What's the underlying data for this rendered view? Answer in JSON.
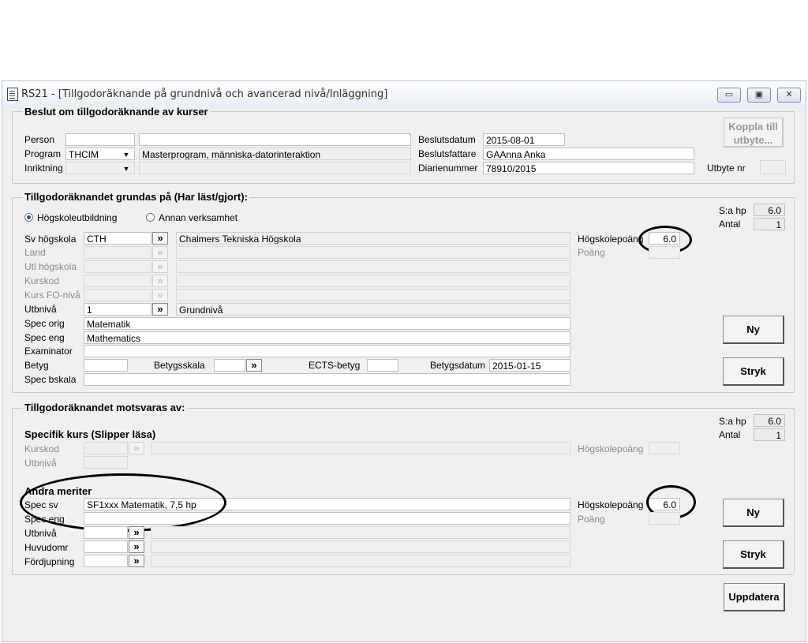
{
  "window": {
    "title": "RS21 - [Tillgodoräknande på grundnivå och avancerad nivå/Inläggning]",
    "minimize": "▭",
    "restore": "▣",
    "close": "✕"
  },
  "beslut": {
    "title": "Beslut om tillgodoräknande av kurser",
    "person_label": "Person",
    "person_id": "",
    "person_name": "",
    "program_label": "Program",
    "program_code": "THCIM",
    "program_name": "Masterprogram, människa-datorinteraktion",
    "inriktning_label": "Inriktning",
    "beslutsdatum_label": "Beslutsdatum",
    "beslutsdatum": "2015-08-01",
    "beslutsfattare_label": "Beslutsfattare",
    "beslutsfattare": "GAAnna Anka",
    "diarienummer_label": "Diarienummer",
    "diarienummer": "78910/2015",
    "koppla_line1": "Koppla till",
    "koppla_line2": "utbyte...",
    "utbyte_label": "Utbyte nr"
  },
  "grundas": {
    "title": "Tillgodoräknandet grundas på (Har läst/gjort):",
    "radio_hogskola": "Högskoleutbildning",
    "radio_annan": "Annan verksamhet",
    "sa_hp_label": "S:a hp",
    "sa_hp": "6.0",
    "antal_label": "Antal",
    "antal": "1",
    "sv_hogskola_label": "Sv högskola",
    "sv_hogskola_code": "CTH",
    "sv_hogskola_name": "Chalmers Tekniska Högskola",
    "land_label": "Land",
    "utl_hogskola_label": "Utl högskola",
    "kurskod_label": "Kurskod",
    "kurs_fo_label": "Kurs FO-nivå",
    "utbniva_label": "Utbnivå",
    "utbniva_code": "1",
    "utbniva_name": "Grundnivå",
    "spec_orig_label": "Spec orig",
    "spec_orig": "Matematik",
    "spec_eng_label": "Spec eng",
    "spec_eng": "Mathematics",
    "examinator_label": "Examinator",
    "betyg_label": "Betyg",
    "betygsskala_label": "Betygsskala",
    "ects_label": "ECTS-betyg",
    "betygsdatum_label": "Betygsdatum",
    "betygsdatum": "2015-01-15",
    "spec_bskala_label": "Spec bskala",
    "hogskolepoang_label": "Högskolepoäng",
    "hogskolepoang": "6.0",
    "poang_label": "Poäng",
    "ny_label": "Ny",
    "stryk_label": "Stryk"
  },
  "motsvaras": {
    "title": "Tillgodoräknandet motsvaras av:",
    "sa_hp_label": "S:a hp",
    "sa_hp": "6.0",
    "antal_label": "Antal",
    "antal": "1",
    "specifik_title": "Specifik kurs (Slipper läsa)",
    "kurskod_label": "Kurskod",
    "utbniva_label": "Utbnivå",
    "hogskolepoang_label": "Högskolepoäng",
    "andra_title": "Andra meriter",
    "spec_sv_label": "Spec sv",
    "spec_sv": "SF1xxx Matematik, 7,5 hp",
    "spec_eng_label": "Spec eng",
    "utbniva2_label": "Utbnivå",
    "huvudomr_label": "Huvudomr",
    "fordjupning_label": "Fördjupning",
    "hogskolepoang2_label": "Högskolepoäng",
    "hogskolepoang2": "6.0",
    "poang_label": "Poäng",
    "ny_label": "Ny",
    "stryk_label": "Stryk",
    "uppdatera_label": "Uppdatera"
  },
  "icons": {
    "lookup": "»"
  }
}
